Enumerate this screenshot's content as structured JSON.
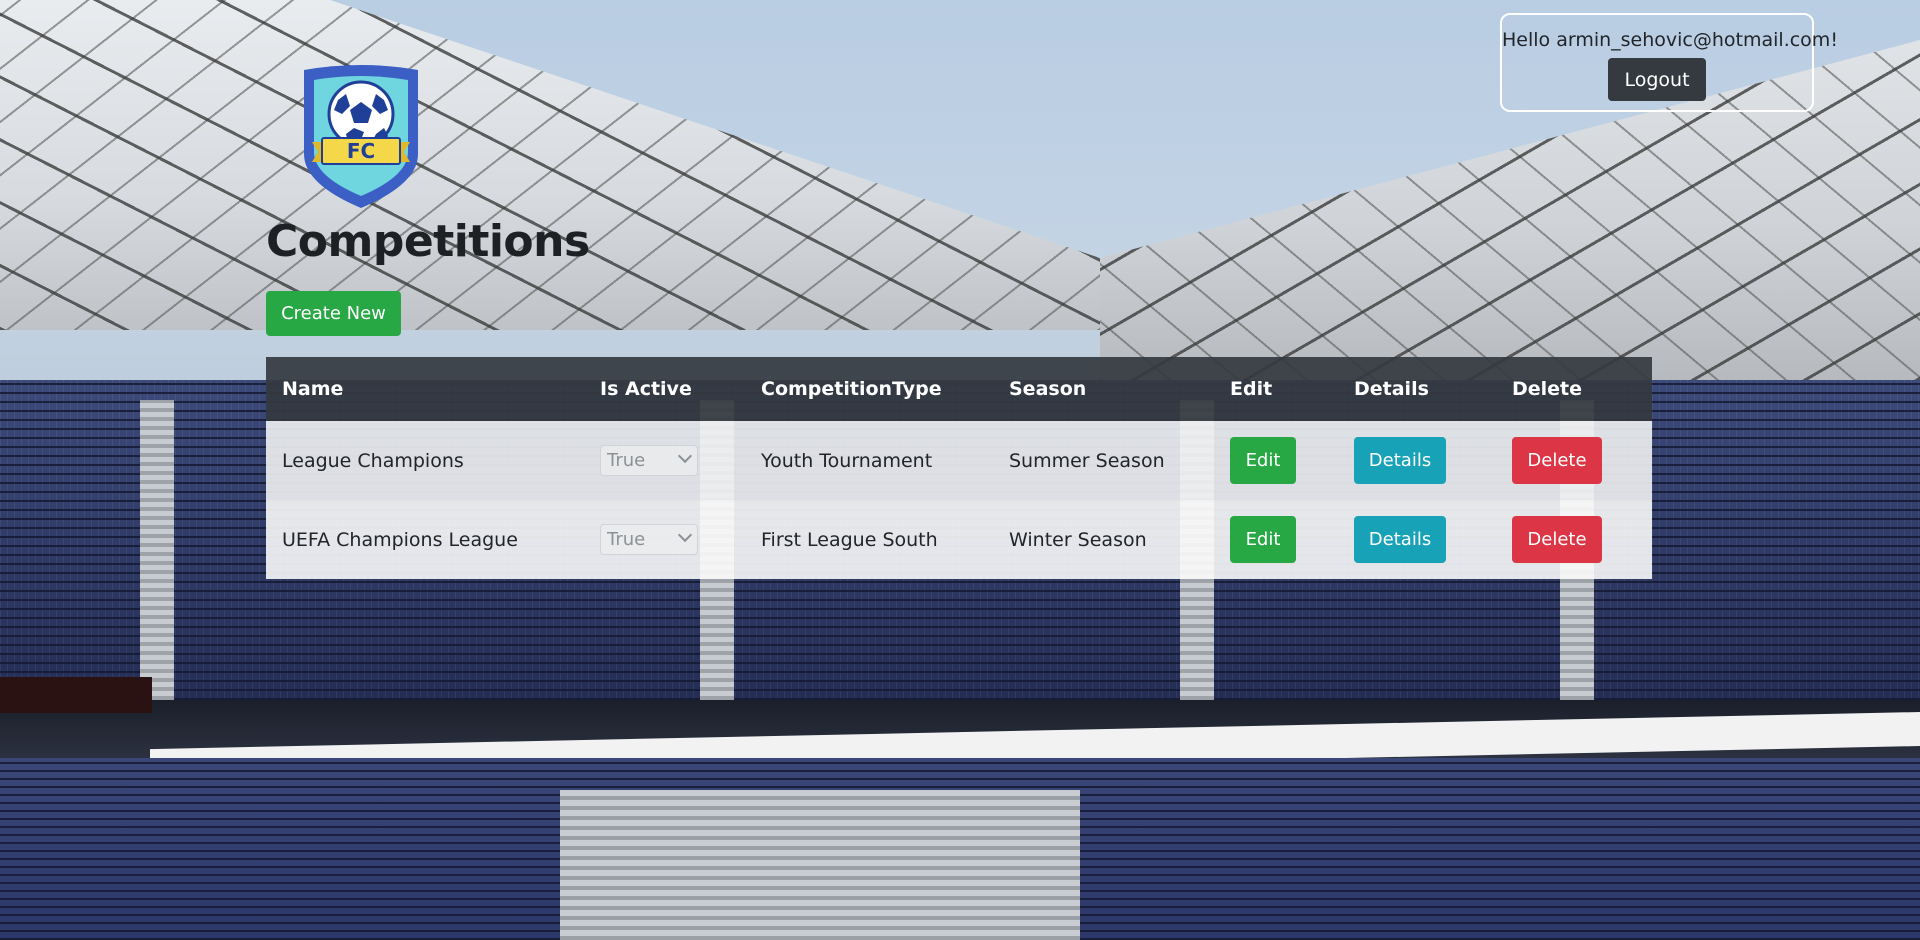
{
  "account": {
    "greeting": "Hello armin_sehovic@hotmail.com!",
    "logout_label": "Logout"
  },
  "logo": {
    "text": "FC",
    "colors": {
      "shield": "#3b5fc4",
      "inner": "#6fd6e0",
      "ribbon": "#f5d84a"
    }
  },
  "page": {
    "title": "Competitions",
    "create_label": "Create New"
  },
  "table": {
    "headers": [
      "Name",
      "Is Active",
      "CompetitionType",
      "Season",
      "Edit",
      "Details",
      "Delete"
    ],
    "rows": [
      {
        "name": "League Champions",
        "is_active": "True",
        "competition_type": "Youth Tournament",
        "season": "Summer Season",
        "edit_label": "Edit",
        "details_label": "Details",
        "delete_label": "Delete"
      },
      {
        "name": "UEFA Champions League",
        "is_active": "True",
        "competition_type": "First League South",
        "season": "Winter Season",
        "edit_label": "Edit",
        "details_label": "Details",
        "delete_label": "Delete"
      }
    ]
  },
  "colors": {
    "success": "#28a745",
    "info": "#17a2b8",
    "danger": "#dc3545",
    "dark": "#343a40"
  }
}
